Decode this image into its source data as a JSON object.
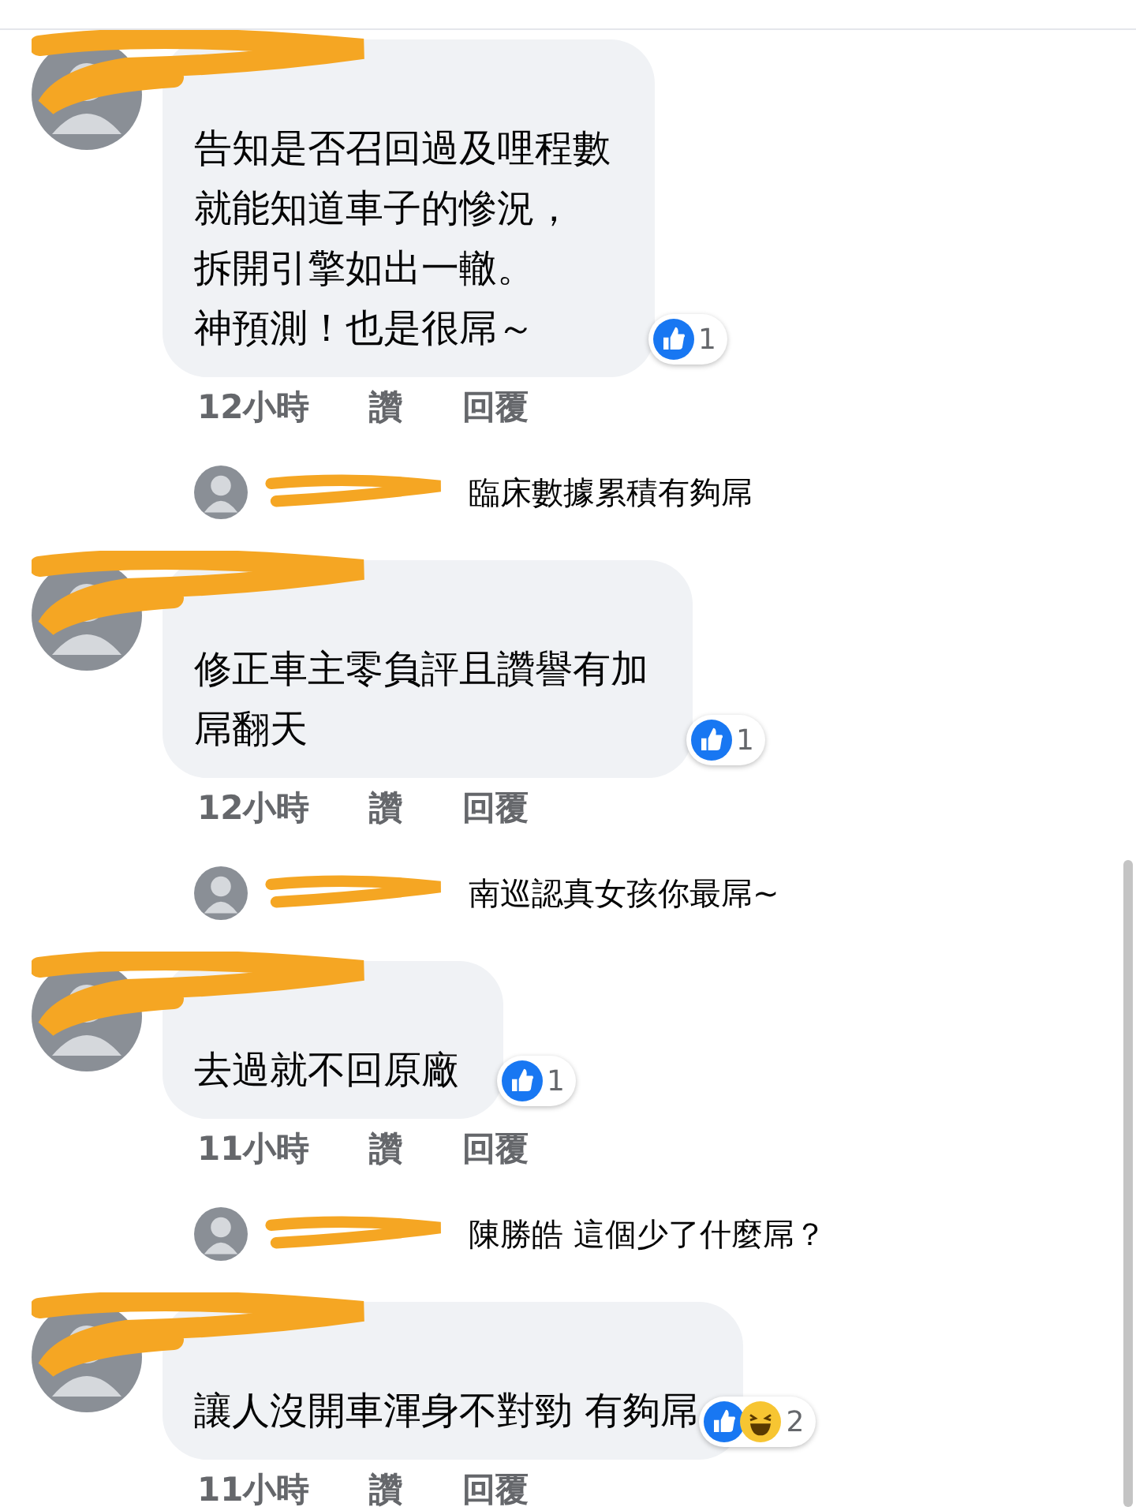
{
  "comments": [
    {
      "name_redacted": true,
      "text_lines": [
        "告知是否召回過及哩程數",
        "就能知道車子的慘況，",
        "拆開引擎如出一轍。",
        "神預測！也是很屌～"
      ],
      "reactions": [
        {
          "kind": "like"
        }
      ],
      "reaction_count": "1",
      "time": "12小時",
      "like": "讚",
      "reply": "回覆",
      "reply_preview": {
        "name_redacted": true,
        "text": "臨床數據累積有夠屌"
      }
    },
    {
      "name_redacted": true,
      "text_lines": [
        "修正車主零負評且讚譽有加",
        "屌翻天"
      ],
      "reactions": [
        {
          "kind": "like"
        }
      ],
      "reaction_count": "1",
      "time": "12小時",
      "like": "讚",
      "reply": "回覆",
      "reply_preview": {
        "name_redacted": true,
        "text": "南巡認真女孩你最屌~"
      }
    },
    {
      "name_redacted": true,
      "text_lines": [
        "去過就不回原廠"
      ],
      "reactions": [
        {
          "kind": "like"
        }
      ],
      "reaction_count": "1",
      "time": "11小時",
      "like": "讚",
      "reply": "回覆",
      "reply_preview": {
        "name_redacted": true,
        "text": "陳勝皓 這個少了什麼屌？"
      }
    },
    {
      "name_redacted": true,
      "text_lines": [
        "讓人沒開車渾身不對勁 有夠屌"
      ],
      "reactions": [
        {
          "kind": "like"
        },
        {
          "kind": "haha"
        }
      ],
      "reaction_count": "2",
      "time": "11小時",
      "like": "讚",
      "reply": "回覆"
    }
  ]
}
